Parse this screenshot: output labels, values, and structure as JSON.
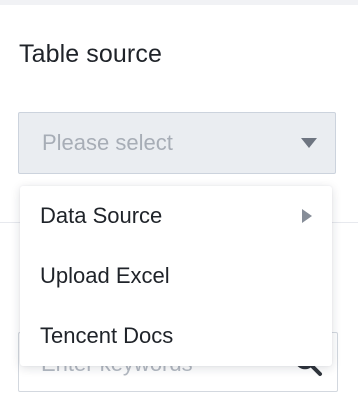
{
  "form": {
    "table_source_label": "Table source",
    "select_placeholder": "Please select",
    "search_placeholder": "Enter keywords"
  },
  "dropdown": {
    "items": [
      {
        "label": "Data Source",
        "has_submenu": true
      },
      {
        "label": "Upload Excel",
        "has_submenu": false
      },
      {
        "label": "Tencent Docs",
        "has_submenu": false
      }
    ]
  },
  "icons": {
    "caret": "chevron-down-icon",
    "submenu": "chevron-right-icon",
    "search": "search-icon"
  },
  "colors": {
    "text_primary": "#1f2329",
    "placeholder": "#a7adb6",
    "select_background": "#eaedf1",
    "select_border": "#ccd3dd"
  }
}
